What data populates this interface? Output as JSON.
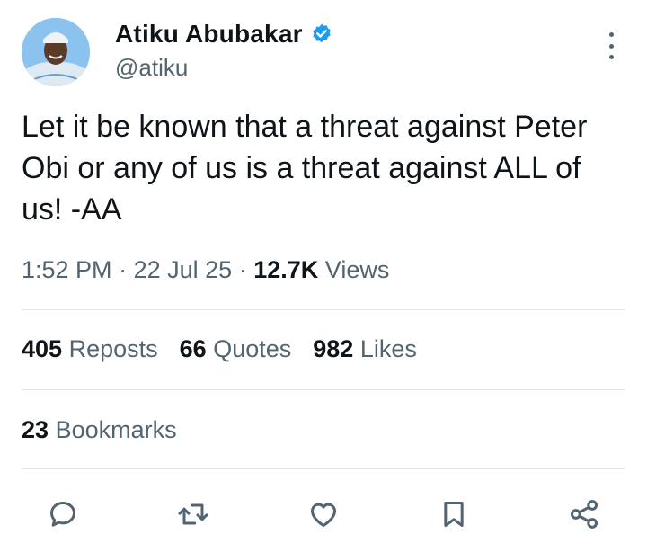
{
  "author": {
    "display_name": "Atiku Abubakar",
    "handle": "@atiku",
    "verified_color": "#1d9bf0",
    "avatar_icon": "profile-photo"
  },
  "tweet": {
    "text": "Let it be known that a threat against Peter Obi or any of us is a threat against ALL of us! -AA",
    "time": "1:52 PM",
    "separator": "·",
    "date": "22 Jul 25",
    "views_count": "12.7K",
    "views_label": "Views"
  },
  "stats": {
    "reposts_count": "405",
    "reposts_label": "Reposts",
    "quotes_count": "66",
    "quotes_label": "Quotes",
    "likes_count": "982",
    "likes_label": "Likes",
    "bookmarks_count": "23",
    "bookmarks_label": "Bookmarks"
  },
  "actions": [
    "reply-icon",
    "repost-icon",
    "like-icon",
    "bookmark-icon",
    "share-icon"
  ],
  "colors": {
    "text_primary": "#0f1419",
    "text_secondary": "#536471",
    "divider": "#e1e6ea",
    "accent": "#1d9bf0"
  }
}
